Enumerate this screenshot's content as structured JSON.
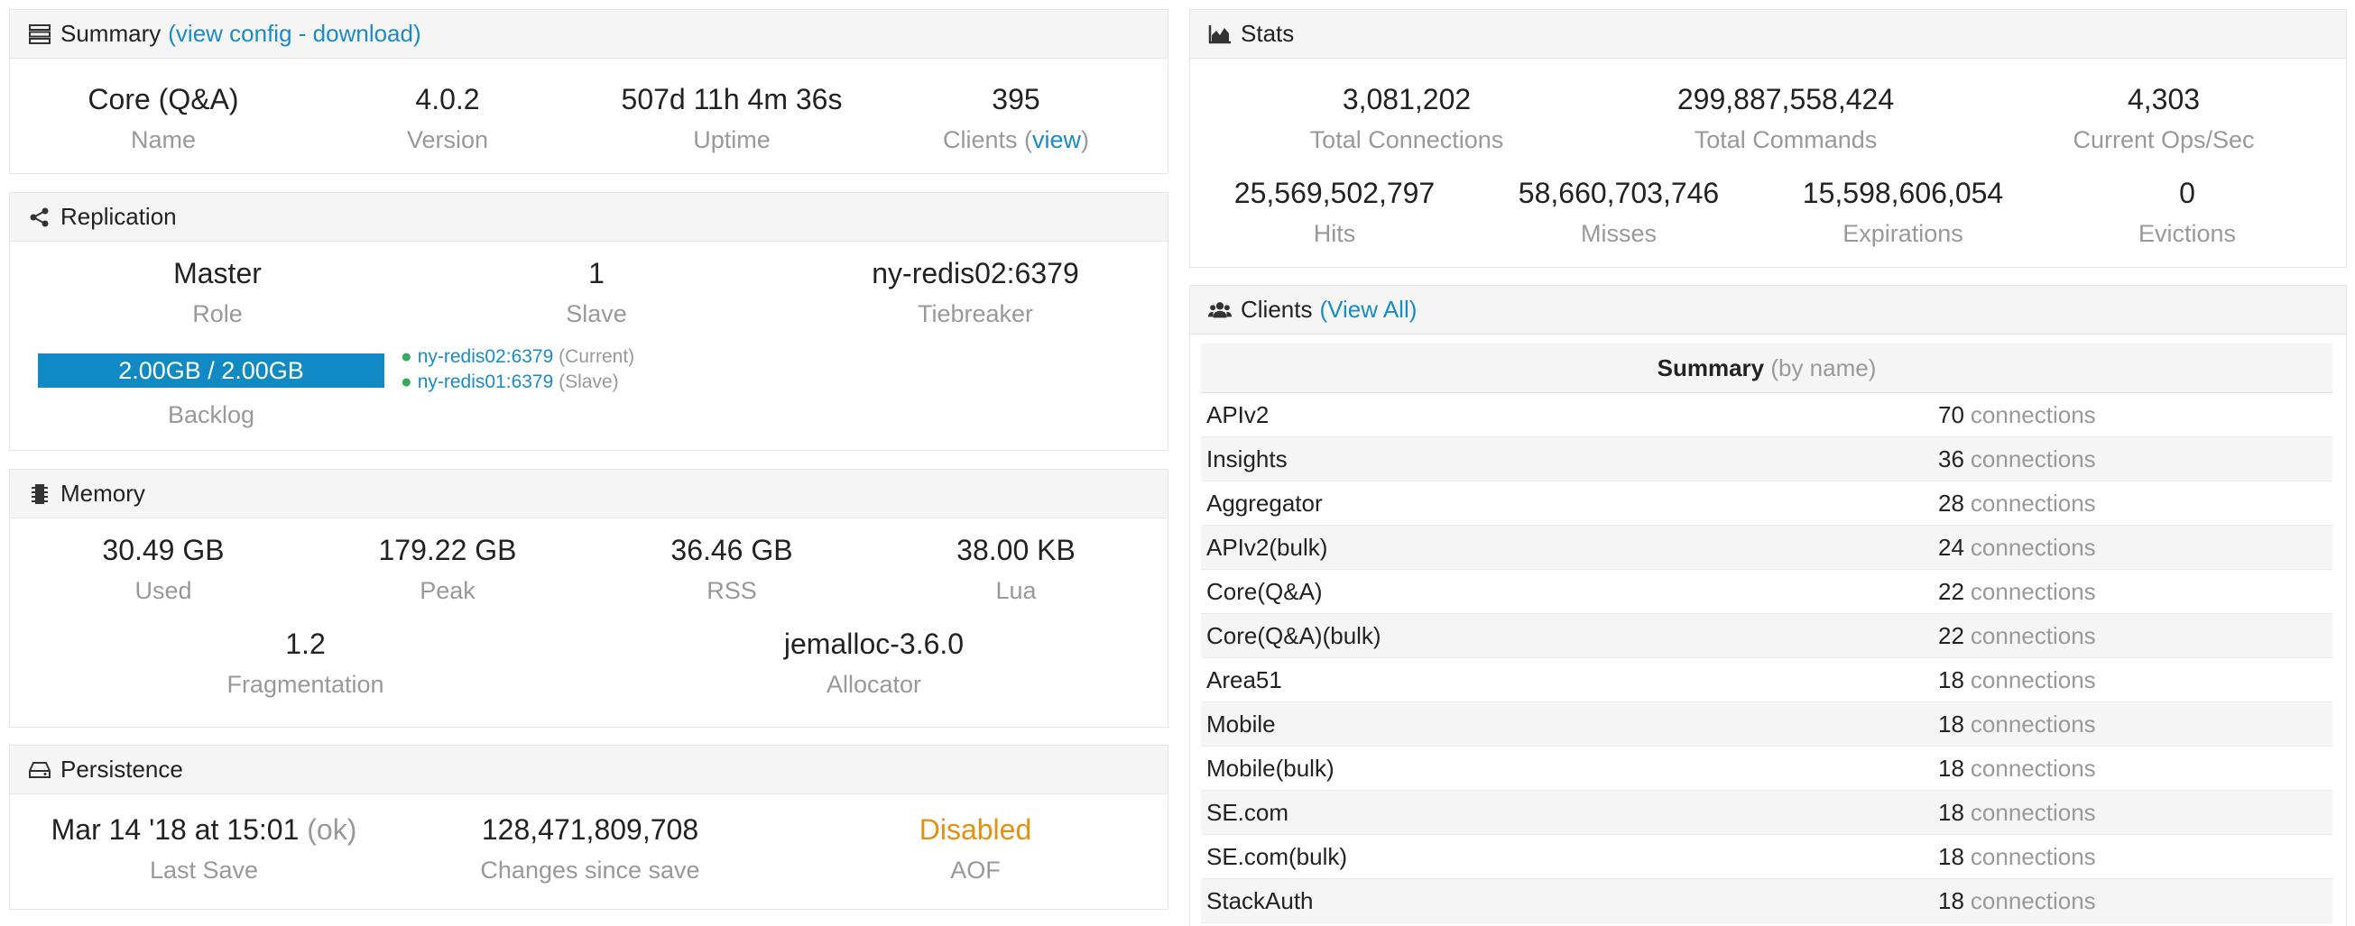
{
  "summary": {
    "title": "Summary",
    "paren_open": "(",
    "view_config": "view config",
    "sep": " - ",
    "download": "download",
    "paren_close": ")",
    "items": [
      {
        "value": "Core (Q&A)",
        "label": "Name"
      },
      {
        "value": "4.0.2",
        "label": "Version"
      },
      {
        "value": "507d 11h 4m 36s",
        "label": "Uptime"
      },
      {
        "value": "395",
        "label": "Clients",
        "link": "view"
      }
    ]
  },
  "replication": {
    "title": "Replication",
    "items": [
      {
        "value": "Master",
        "label": "Role"
      },
      {
        "value": "1",
        "label": "Slave"
      },
      {
        "value": "ny-redis02:6379",
        "label": "Tiebreaker"
      }
    ],
    "backlog": {
      "value": "2.00GB / 2.00GB",
      "label": "Backlog",
      "fill": 1.0
    },
    "slaves": [
      {
        "host": "ny-redis02:6379",
        "status": "(Current)"
      },
      {
        "host": "ny-redis01:6379",
        "status": "(Slave)"
      }
    ]
  },
  "memory": {
    "title": "Memory",
    "items": [
      {
        "value": "30.49 GB",
        "label": "Used"
      },
      {
        "value": "179.22 GB",
        "label": "Peak"
      },
      {
        "value": "36.46 GB",
        "label": "RSS"
      },
      {
        "value": "38.00 KB",
        "label": "Lua"
      },
      {
        "value": "1.2",
        "label": "Fragmentation"
      },
      {
        "value": "jemalloc-3.6.0",
        "label": "Allocator"
      }
    ]
  },
  "persistence": {
    "title": "Persistence",
    "last_save": {
      "value": "Mar 14 '18 at 15:01",
      "status": "(ok)",
      "label": "Last Save"
    },
    "changes": {
      "value": "128,471,809,708",
      "label": "Changes since save"
    },
    "aof": {
      "value": "Disabled",
      "label": "AOF"
    }
  },
  "stats": {
    "title": "Stats",
    "items": [
      {
        "value": "3,081,202",
        "label": "Total Connections"
      },
      {
        "value": "299,887,558,424",
        "label": "Total Commands"
      },
      {
        "value": "4,303",
        "label": "Current Ops/Sec"
      },
      {
        "value": "25,569,502,797",
        "label": "Hits"
      },
      {
        "value": "58,660,703,746",
        "label": "Misses"
      },
      {
        "value": "15,598,606,054",
        "label": "Expirations"
      },
      {
        "value": "0",
        "label": "Evictions"
      }
    ]
  },
  "clients": {
    "title": "Clients",
    "view_all": "View All",
    "table_title": "Summary",
    "table_subtitle": "(by name)",
    "conn_word": "connections",
    "rows": [
      {
        "name": "APIv2",
        "count": "70"
      },
      {
        "name": "Insights",
        "count": "36"
      },
      {
        "name": "Aggregator",
        "count": "28"
      },
      {
        "name": "APIv2(bulk)",
        "count": "24"
      },
      {
        "name": "Core(Q&A)",
        "count": "22"
      },
      {
        "name": "Core(Q&A)(bulk)",
        "count": "22"
      },
      {
        "name": "Area51",
        "count": "18"
      },
      {
        "name": "Mobile",
        "count": "18"
      },
      {
        "name": "Mobile(bulk)",
        "count": "18"
      },
      {
        "name": "SE.com",
        "count": "18"
      },
      {
        "name": "SE.com(bulk)",
        "count": "18"
      },
      {
        "name": "StackAuth",
        "count": "18"
      }
    ]
  },
  "icons": {
    "summary": "server-list-icon",
    "replication": "share-icon",
    "memory": "memory-chip-icon",
    "persistence": "hard-drive-icon",
    "stats": "area-chart-icon",
    "clients": "users-icon"
  },
  "colors": {
    "link": "#1a8bc4",
    "backlog_bar": "#118ac3",
    "aof_disabled": "#e6900f",
    "slave_dot": "#3aa85e",
    "muted": "#999999"
  }
}
